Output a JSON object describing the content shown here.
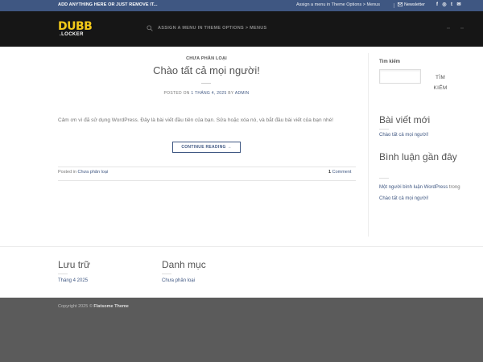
{
  "topbar": {
    "promo": "ADD ANYTHING HERE OR JUST REMOVE IT...",
    "menu_hint": "Assign a menu in Theme Options > Menus",
    "newsletter": "Newsletter",
    "socials": [
      {
        "icon": "facebook-icon",
        "glyph": "f"
      },
      {
        "icon": "instagram-icon",
        "glyph": "◎"
      },
      {
        "icon": "twitter-icon",
        "glyph": "t"
      },
      {
        "icon": "email-icon",
        "glyph": "✉"
      }
    ]
  },
  "header": {
    "logo_main": "DUBB",
    "logo_sub": ".LOCKER",
    "menu_hint": "ASSIGN A MENU IN THEME OPTIONS > MENUS"
  },
  "post": {
    "category": "CHƯA PHÂN LOẠI",
    "title": "Chào tất cả mọi người!",
    "meta_prefix": "POSTED ON",
    "meta_date": "1 THÁNG 4, 2025",
    "meta_by": "BY",
    "meta_author": "ADMIN",
    "excerpt": "Cảm ơn vì đã sử dụng WordPress. Đây là bài viết đầu tiên của bạn. Sửa hoặc xóa nó, và bắt đầu bài viết của bạn nhé!",
    "continue_label": "CONTINUE READING →",
    "posted_in_prefix": "Posted in",
    "posted_in_category": "Chưa phân loại",
    "comments_count": "1",
    "comments_label": "Comment"
  },
  "sidebar": {
    "search_title": "Tìm kiếm",
    "search_placeholder": "",
    "search_button_line1": "TÌM",
    "search_button_line2": "KIẾM",
    "recent_posts_title": "Bài viết mới",
    "recent_post_link": "Chào tất cả mọi người!",
    "recent_comments_title": "Bình luận gần đây",
    "comment_author": "Một người bình luận WordPress",
    "comment_on": "trong",
    "comment_post": "Chào tất cả mọi người!"
  },
  "footer": {
    "archives_title": "Lưu trữ",
    "archives_link": "Tháng 4 2025",
    "categories_title": "Danh mục",
    "categories_link": "Chưa phân loại",
    "copyright_prefix": "Copyright 2025 ©",
    "copyright_brand": "Flatsome Theme"
  },
  "colors": {
    "topbar": "#3f5782",
    "header": "#161616",
    "logo": "#f2c919",
    "link": "#3f5782",
    "footer": "#5b5b5b"
  }
}
